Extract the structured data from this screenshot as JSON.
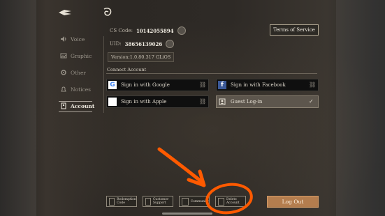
{
  "info": {
    "cs_code_label": "CS Code:",
    "cs_code_value": "10142055894",
    "uid_label": "UID:",
    "uid_value": "38656139026",
    "version": "Version:1.0.80.317 GLiOS"
  },
  "header": {
    "terms_label": "Terms of Service"
  },
  "sidebar": {
    "items": [
      {
        "label": "Voice",
        "icon": "speaker-icon"
      },
      {
        "label": "Graphic",
        "icon": "image-icon"
      },
      {
        "label": "Other",
        "icon": "gear-icon"
      },
      {
        "label": "Notices",
        "icon": "bell-icon"
      },
      {
        "label": "Account",
        "icon": "account-card-icon"
      }
    ],
    "active": "Account"
  },
  "connect": {
    "title": "Connect Account",
    "google": "Sign in with Google",
    "facebook": "Sign in with Facebook",
    "apple": "Sign in with Apple",
    "guest": "Guest Log-in"
  },
  "footer": {
    "redemption": "Redemption Code",
    "customer_support": "Customer Support",
    "community": "Community",
    "delete_account": "Delete Account",
    "logout": "Log Out"
  },
  "colors": {
    "accent_logout": "#b47d4e",
    "annotation": "#ff5a00",
    "facebook": "#3b5998"
  }
}
